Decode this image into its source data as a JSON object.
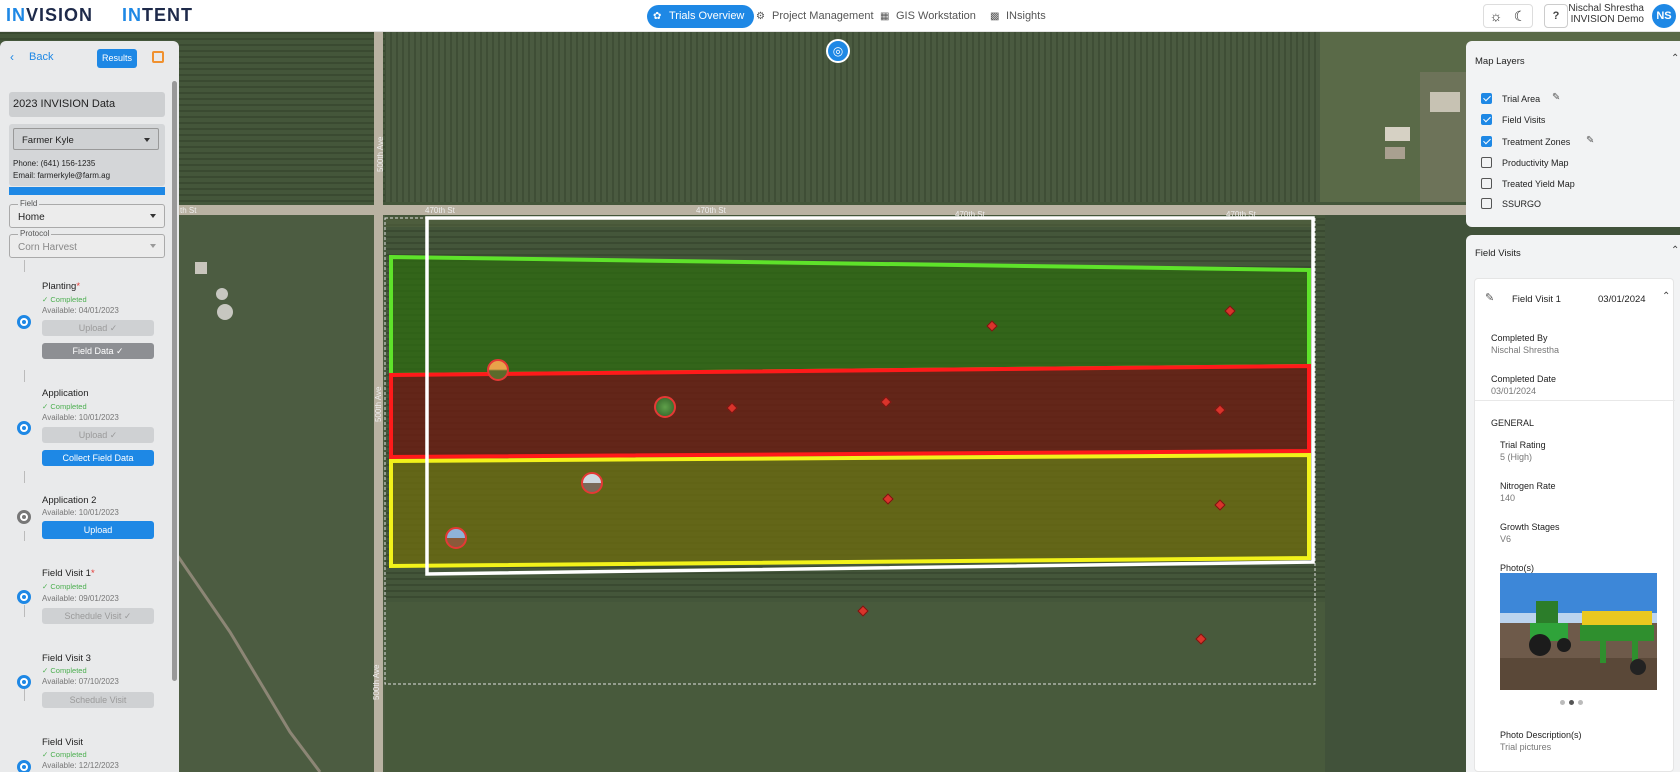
{
  "header": {
    "logo_left": "INVISION",
    "logo_right": "INTENT",
    "tabs": [
      {
        "label": "Trials Overview",
        "active": true
      },
      {
        "label": "Project Management",
        "active": false
      },
      {
        "label": "GIS Workstation",
        "active": false
      },
      {
        "label": "INsights",
        "active": false
      }
    ],
    "user_name": "Nischal Shrestha",
    "user_org": "INVISION Demo",
    "avatar": "NS",
    "help": "?"
  },
  "left_panel": {
    "back_label": "Back",
    "results_label": "Results",
    "dataset_title": "2023 INVISION Data",
    "farmer": "Farmer Kyle",
    "phone": "Phone: (641) 156-1235",
    "email": "Email: farmerkyle@farm.ag",
    "field_label": "Field",
    "field_value": "Home",
    "protocol_label": "Protocol",
    "protocol_value": "Corn Harvest",
    "steps": [
      {
        "name": "Planting",
        "required": "*",
        "status": "Completed",
        "available": "Available: 04/01/2023",
        "btn1": "Upload",
        "btn2": "Field Data"
      },
      {
        "name": "Application",
        "status": "Completed",
        "available": "Available: 10/01/2023",
        "btn1": "Upload",
        "btn2": "Collect Field Data"
      },
      {
        "name": "Application 2",
        "available": "Available: 10/01/2023",
        "btn1": "Upload"
      },
      {
        "name": "Field Visit 1",
        "required": "*",
        "status": "Completed",
        "available": "Available: 09/01/2023",
        "btn1": "Schedule Visit"
      },
      {
        "name": "Field Visit 3",
        "status": "Completed",
        "available": "Available: 07/10/2023",
        "btn1": "Schedule Visit"
      },
      {
        "name": "Field Visit",
        "status": "Completed",
        "available": "Available: 12/12/2023"
      }
    ]
  },
  "map": {
    "road_labels": [
      "500th Ave",
      "470th St",
      "470th St",
      "470th St",
      "470th St",
      "500th Ave",
      "500th Ave",
      "th St"
    ],
    "colors": {
      "zone_green": "#5ee22a",
      "zone_red": "#ff1a1a",
      "zone_yellow": "#f2f21a",
      "trial_area": "#ffffff",
      "marker": "#d9342b"
    }
  },
  "map_layers": {
    "title": "Map Layers",
    "items": [
      {
        "label": "Trial Area",
        "checked": true,
        "editable": true
      },
      {
        "label": "Field Visits",
        "checked": true,
        "editable": false
      },
      {
        "label": "Treatment Zones",
        "checked": true,
        "editable": true
      },
      {
        "label": "Productivity Map",
        "checked": false,
        "editable": false
      },
      {
        "label": "Treated Yield Map",
        "checked": false,
        "editable": false
      },
      {
        "label": "SSURGO",
        "checked": false,
        "editable": false
      }
    ]
  },
  "field_visits": {
    "title": "Field Visits",
    "visit_title": "Field Visit 1",
    "visit_date": "03/01/2024",
    "completed_by_label": "Completed By",
    "completed_by": "Nischal Shrestha",
    "completed_date_label": "Completed Date",
    "completed_date": "03/01/2024",
    "section": "GENERAL",
    "trial_rating_label": "Trial Rating",
    "trial_rating": "5 (High)",
    "nitrogen_label": "Nitrogen Rate",
    "nitrogen": "140",
    "growth_label": "Growth Stages",
    "growth": "V6",
    "photos_label": "Photo(s)",
    "photo_desc_label": "Photo Description(s)",
    "photo_desc": "Trial pictures"
  }
}
